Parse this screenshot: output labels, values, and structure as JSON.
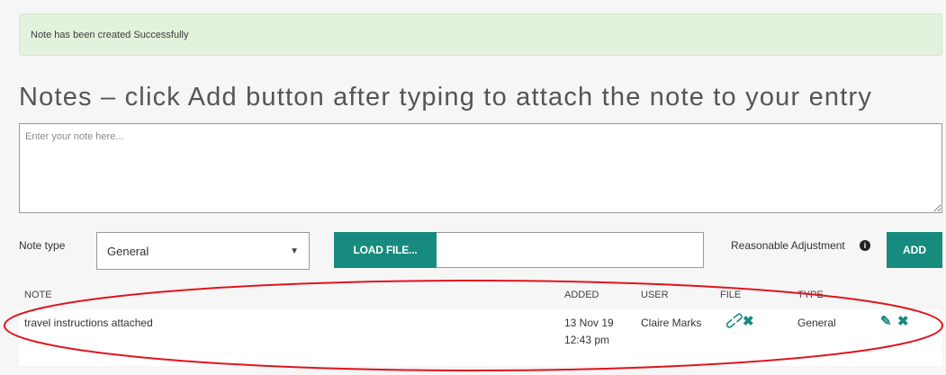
{
  "alert": {
    "message": "Note has been created Successfully"
  },
  "page_title": "Notes – click Add button after typing to attach the note to your entry",
  "note_input": {
    "placeholder": "Enter your note here...",
    "value": ""
  },
  "note_type": {
    "label": "Note type",
    "selected": "General"
  },
  "load_file_button": "LOAD FILE...",
  "reasonable_adjustment": {
    "label": "Reasonable Adjustment",
    "icon": "info-icon"
  },
  "add_button": "ADD",
  "table": {
    "headers": {
      "note": "NOTE",
      "added": "ADDED",
      "user": "USER",
      "file": "FILE",
      "type": "TYPE"
    },
    "rows": [
      {
        "note": "travel instructions attached",
        "added_date": "13 Nov 19",
        "added_time": "12:43 pm",
        "user": "Claire Marks",
        "file_icons": [
          "paperclip-icon",
          "delete-file-icon"
        ],
        "type": "General",
        "action_icons": [
          "edit-icon",
          "delete-icon"
        ]
      }
    ]
  },
  "annotation": {
    "shape": "red-oval",
    "color": "#e0141e"
  },
  "colors": {
    "accent": "#178b7d",
    "alert_bg": "#e3f2dc"
  }
}
